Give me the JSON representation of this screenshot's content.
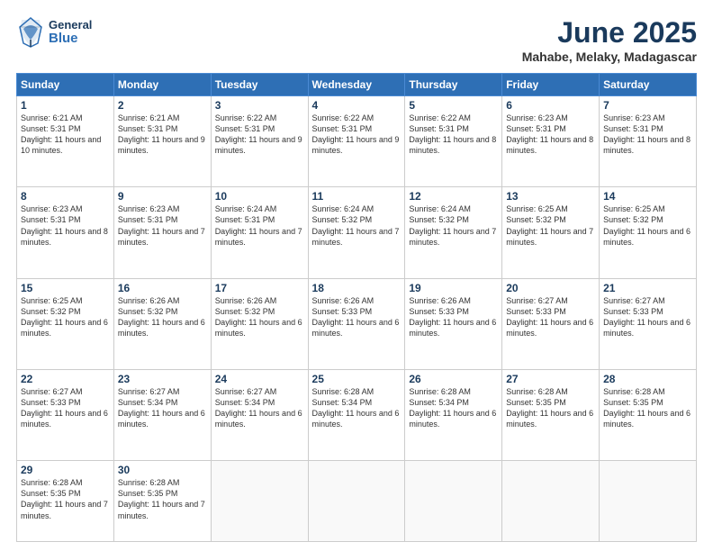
{
  "header": {
    "logo_general": "General",
    "logo_blue": "Blue",
    "month_title": "June 2025",
    "subtitle": "Mahabe, Melaky, Madagascar"
  },
  "days_of_week": [
    "Sunday",
    "Monday",
    "Tuesday",
    "Wednesday",
    "Thursday",
    "Friday",
    "Saturday"
  ],
  "weeks": [
    [
      {
        "num": "1",
        "sunrise": "6:21 AM",
        "sunset": "5:31 PM",
        "daylight": "11 hours and 10 minutes."
      },
      {
        "num": "2",
        "sunrise": "6:21 AM",
        "sunset": "5:31 PM",
        "daylight": "11 hours and 9 minutes."
      },
      {
        "num": "3",
        "sunrise": "6:22 AM",
        "sunset": "5:31 PM",
        "daylight": "11 hours and 9 minutes."
      },
      {
        "num": "4",
        "sunrise": "6:22 AM",
        "sunset": "5:31 PM",
        "daylight": "11 hours and 9 minutes."
      },
      {
        "num": "5",
        "sunrise": "6:22 AM",
        "sunset": "5:31 PM",
        "daylight": "11 hours and 8 minutes."
      },
      {
        "num": "6",
        "sunrise": "6:23 AM",
        "sunset": "5:31 PM",
        "daylight": "11 hours and 8 minutes."
      },
      {
        "num": "7",
        "sunrise": "6:23 AM",
        "sunset": "5:31 PM",
        "daylight": "11 hours and 8 minutes."
      }
    ],
    [
      {
        "num": "8",
        "sunrise": "6:23 AM",
        "sunset": "5:31 PM",
        "daylight": "11 hours and 8 minutes."
      },
      {
        "num": "9",
        "sunrise": "6:23 AM",
        "sunset": "5:31 PM",
        "daylight": "11 hours and 7 minutes."
      },
      {
        "num": "10",
        "sunrise": "6:24 AM",
        "sunset": "5:31 PM",
        "daylight": "11 hours and 7 minutes."
      },
      {
        "num": "11",
        "sunrise": "6:24 AM",
        "sunset": "5:32 PM",
        "daylight": "11 hours and 7 minutes."
      },
      {
        "num": "12",
        "sunrise": "6:24 AM",
        "sunset": "5:32 PM",
        "daylight": "11 hours and 7 minutes."
      },
      {
        "num": "13",
        "sunrise": "6:25 AM",
        "sunset": "5:32 PM",
        "daylight": "11 hours and 7 minutes."
      },
      {
        "num": "14",
        "sunrise": "6:25 AM",
        "sunset": "5:32 PM",
        "daylight": "11 hours and 6 minutes."
      }
    ],
    [
      {
        "num": "15",
        "sunrise": "6:25 AM",
        "sunset": "5:32 PM",
        "daylight": "11 hours and 6 minutes."
      },
      {
        "num": "16",
        "sunrise": "6:26 AM",
        "sunset": "5:32 PM",
        "daylight": "11 hours and 6 minutes."
      },
      {
        "num": "17",
        "sunrise": "6:26 AM",
        "sunset": "5:32 PM",
        "daylight": "11 hours and 6 minutes."
      },
      {
        "num": "18",
        "sunrise": "6:26 AM",
        "sunset": "5:33 PM",
        "daylight": "11 hours and 6 minutes."
      },
      {
        "num": "19",
        "sunrise": "6:26 AM",
        "sunset": "5:33 PM",
        "daylight": "11 hours and 6 minutes."
      },
      {
        "num": "20",
        "sunrise": "6:27 AM",
        "sunset": "5:33 PM",
        "daylight": "11 hours and 6 minutes."
      },
      {
        "num": "21",
        "sunrise": "6:27 AM",
        "sunset": "5:33 PM",
        "daylight": "11 hours and 6 minutes."
      }
    ],
    [
      {
        "num": "22",
        "sunrise": "6:27 AM",
        "sunset": "5:33 PM",
        "daylight": "11 hours and 6 minutes."
      },
      {
        "num": "23",
        "sunrise": "6:27 AM",
        "sunset": "5:34 PM",
        "daylight": "11 hours and 6 minutes."
      },
      {
        "num": "24",
        "sunrise": "6:27 AM",
        "sunset": "5:34 PM",
        "daylight": "11 hours and 6 minutes."
      },
      {
        "num": "25",
        "sunrise": "6:28 AM",
        "sunset": "5:34 PM",
        "daylight": "11 hours and 6 minutes."
      },
      {
        "num": "26",
        "sunrise": "6:28 AM",
        "sunset": "5:34 PM",
        "daylight": "11 hours and 6 minutes."
      },
      {
        "num": "27",
        "sunrise": "6:28 AM",
        "sunset": "5:35 PM",
        "daylight": "11 hours and 6 minutes."
      },
      {
        "num": "28",
        "sunrise": "6:28 AM",
        "sunset": "5:35 PM",
        "daylight": "11 hours and 6 minutes."
      }
    ],
    [
      {
        "num": "29",
        "sunrise": "6:28 AM",
        "sunset": "5:35 PM",
        "daylight": "11 hours and 7 minutes."
      },
      {
        "num": "30",
        "sunrise": "6:28 AM",
        "sunset": "5:35 PM",
        "daylight": "11 hours and 7 minutes."
      },
      null,
      null,
      null,
      null,
      null
    ]
  ],
  "labels": {
    "sunrise": "Sunrise:",
    "sunset": "Sunset:",
    "daylight": "Daylight:"
  }
}
